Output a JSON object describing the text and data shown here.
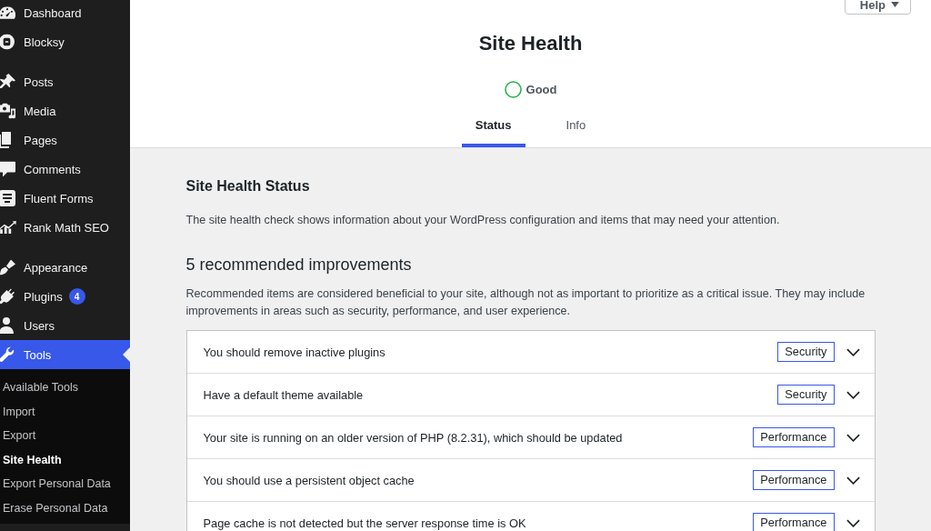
{
  "help_button": {
    "label": "Help"
  },
  "sidebar": {
    "groups": [
      {
        "items": [
          {
            "label": "Dashboard",
            "selected": false
          },
          {
            "label": "Blocksy",
            "selected": false
          }
        ]
      },
      {
        "items": [
          {
            "label": "Posts",
            "selected": false
          },
          {
            "label": "Media",
            "selected": false
          },
          {
            "label": "Pages",
            "selected": false
          },
          {
            "label": "Comments",
            "selected": false
          },
          {
            "label": "Fluent Forms",
            "selected": false
          },
          {
            "label": "Rank Math SEO",
            "selected": false
          }
        ]
      },
      {
        "items": [
          {
            "label": "Appearance",
            "selected": false
          },
          {
            "label": "Plugins",
            "selected": false,
            "badge": "4"
          },
          {
            "label": "Users",
            "selected": false
          },
          {
            "label": "Tools",
            "selected": true,
            "children": [
              {
                "label": "Available Tools",
                "selected": false
              },
              {
                "label": "Import",
                "selected": false
              },
              {
                "label": "Export",
                "selected": false
              },
              {
                "label": "Site Health",
                "selected": true
              },
              {
                "label": "Export Personal Data",
                "selected": false
              },
              {
                "label": "Erase Personal Data",
                "selected": false
              }
            ]
          }
        ]
      }
    ]
  },
  "header": {
    "title": "Site Health",
    "status": "Good",
    "tabs": [
      {
        "label": "Status",
        "selected": true
      },
      {
        "label": "Info",
        "selected": false
      }
    ]
  },
  "status_section": {
    "heading": "Site Health Status",
    "description": "The site health check shows information about your WordPress configuration and items that may need your attention."
  },
  "improvements": {
    "heading": "5 recommended improvements",
    "description": "Recommended items are considered beneficial to your site, although not as important to prioritize as a critical issue. They may include improvements in areas such as security, performance, and user experience.",
    "items": [
      {
        "title": "You should remove inactive plugins",
        "badge": "Security",
        "expanded": false
      },
      {
        "title": "Have a default theme available",
        "badge": "Security",
        "expanded": false
      },
      {
        "title": "Your site is running on an older version of PHP (8.2.31), which should be updated",
        "badge": "Performance",
        "expanded": false
      },
      {
        "title": "You should use a persistent object cache",
        "badge": "Performance",
        "expanded": false
      },
      {
        "title": "Page cache is not detected but the server response time is OK",
        "badge": "Performance",
        "expanded": false
      }
    ]
  }
}
